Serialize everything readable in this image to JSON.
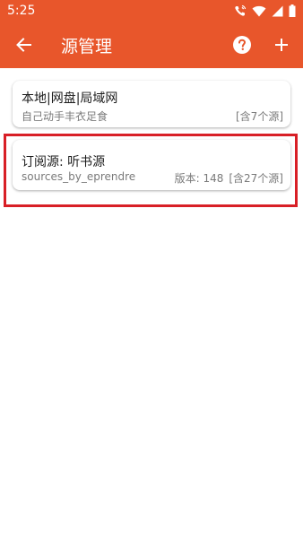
{
  "status": {
    "time": "5:25"
  },
  "appbar": {
    "title": "源管理",
    "back_icon": "arrow-back-icon",
    "help_icon": "help-circle-icon",
    "add_icon": "plus-icon",
    "color": "#e8562b"
  },
  "sources": [
    {
      "title": "本地|网盘|局域网",
      "subtitle": "自己动手丰衣足食",
      "version": "",
      "count": "[含7个源]"
    },
    {
      "title": "订阅源: 听书源",
      "subtitle": "sources_by_eprendre",
      "version": "版本: 148",
      "count": "[含27个源]"
    }
  ],
  "highlight_color": "#d81f26"
}
